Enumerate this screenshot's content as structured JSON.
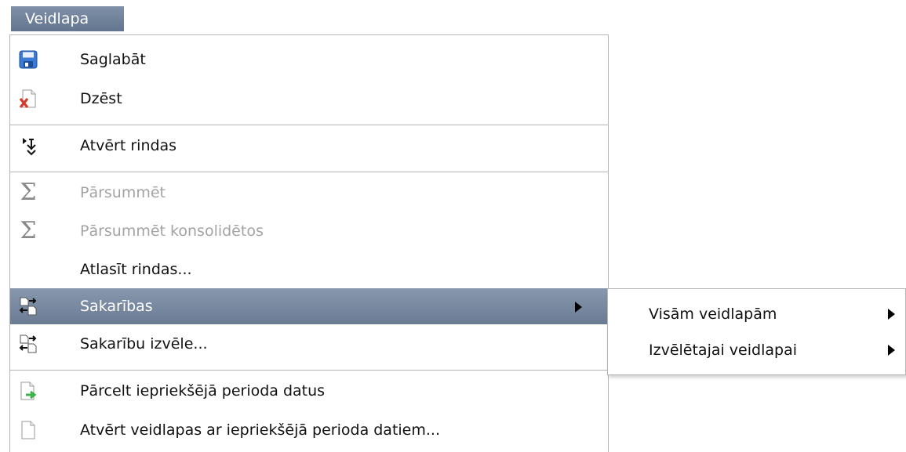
{
  "menubar": {
    "title": "Veidlapa"
  },
  "menu": {
    "items": [
      {
        "label": "Saglabāt",
        "icon": "save-icon"
      },
      {
        "label": "Dzēst",
        "icon": "delete-document-icon"
      },
      {
        "label": "Atvērt rindas",
        "icon": "expand-rows-icon"
      },
      {
        "label": "Pārsummēt",
        "icon": "sigma-icon",
        "disabled": true
      },
      {
        "label": "Pārsummēt konsolidētos",
        "icon": "sigma-icon",
        "disabled": true
      },
      {
        "label": "Atlasīt rindas...",
        "icon": ""
      },
      {
        "label": "Sakarības",
        "icon": "relations-icon",
        "active": true,
        "has_submenu": true
      },
      {
        "label": "Sakarību izvēle...",
        "icon": "relations-icon"
      },
      {
        "label": "Pārcelt iepriekšējā perioda datus",
        "icon": "transfer-document-icon"
      },
      {
        "label": "Atvērt veidlapas ar iepriekšējā perioda datiem...",
        "icon": "document-icon"
      }
    ]
  },
  "submenu": {
    "items": [
      {
        "label": "Visām veidlapām",
        "has_submenu": true
      },
      {
        "label": "Izvēlētajai veidlapai",
        "has_submenu": true
      }
    ]
  },
  "colors": {
    "highlight": "#7889a0",
    "disabled_text": "#a3a3a3",
    "save_blue": "#3a7bd5",
    "delete_red": "#d83a2a",
    "arrow_green": "#3bb24a"
  }
}
